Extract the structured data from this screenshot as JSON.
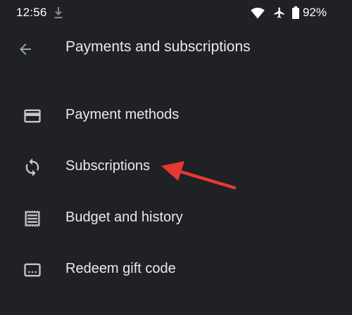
{
  "status_bar": {
    "time": "12:56",
    "battery": "92%",
    "icons": [
      "download-icon",
      "wifi-icon",
      "airplane-icon",
      "battery-icon"
    ]
  },
  "header": {
    "back_icon": "arrow-back-icon",
    "title": "Payments and subscriptions"
  },
  "menu": {
    "items": [
      {
        "label": "Payment methods",
        "icon": "credit-card-icon"
      },
      {
        "label": "Subscriptions",
        "icon": "sync-icon"
      },
      {
        "label": "Budget and history",
        "icon": "receipt-icon"
      },
      {
        "label": "Redeem gift code",
        "icon": "gift-code-icon"
      }
    ]
  },
  "annotation": {
    "color": "#e53935",
    "target": "Subscriptions"
  },
  "colors": {
    "background": "#202124",
    "text": "#e8eaed",
    "icon": "#c4c7c5"
  }
}
